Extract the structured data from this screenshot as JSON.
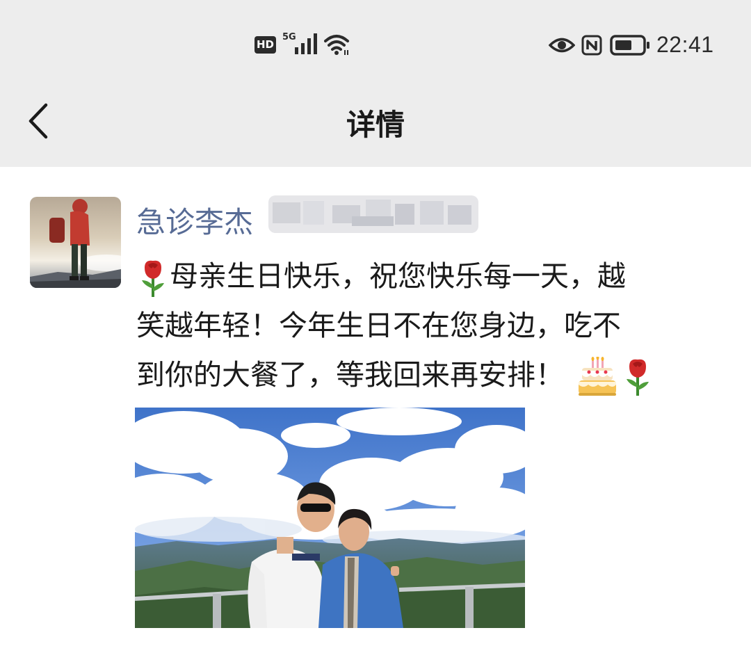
{
  "status_bar": {
    "hd_label": "HD",
    "network_label": "5G",
    "time": "22:41",
    "icons": [
      "hd-icon",
      "signal-icon",
      "wifi-icon",
      "eye-icon",
      "nfc-icon",
      "battery-icon"
    ]
  },
  "nav": {
    "title": "详情",
    "back_icon": "chevron-left-icon"
  },
  "post": {
    "author": "急诊李杰",
    "text_lines": [
      "母亲生日快乐，祝您快乐每一天，越",
      "笑越年轻！今年生日不在您身边，吃不",
      "到你的大餐了，等我回来再安排！"
    ],
    "emojis": [
      "rose-emoji",
      "birthday-cake-emoji",
      "rose-emoji"
    ]
  },
  "colors": {
    "header_bg": "#ededed",
    "author_link": "#576b95",
    "text": "#1a1a1a"
  }
}
